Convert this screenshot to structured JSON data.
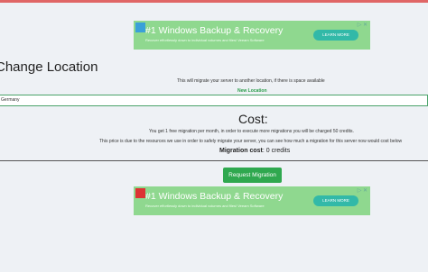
{
  "ads": {
    "top": {
      "title": "#1 Windows Backup & Recovery",
      "subtitle": "Recover effortlessly down to individual volumes and files! Veeam Software",
      "button": "LEARN MORE",
      "info": "▷ ✕",
      "logo": "veeam"
    },
    "bottom": {
      "title": "#1 Windows Backup & Recovery",
      "subtitle": "Recover effortlessly down to individual volumes and files! Veeam Software",
      "button": "LEARN MORE",
      "info": "▷ ✕",
      "logo": "veeam"
    }
  },
  "change_location": {
    "title": "Change Location",
    "description": "This will migrate your server to another location, if there is space available",
    "new_location_label": "New Location",
    "selected_location": "Germany"
  },
  "cost": {
    "title": "Cost:",
    "line1": "You get 1 free migration per month, in order to execute more migrations you will be charged 50 credits.",
    "line2": "This price is due to the resources we use in order to safely migrate your server, you can see how much a migration for this server now would cost below",
    "migration_cost_label": "Migration cost",
    "migration_cost_value": ": 0 credits"
  },
  "actions": {
    "request_migration": "Request Migration"
  },
  "colors": {
    "accent_top": "#e06666",
    "ad_background": "#8fd88f",
    "primary_button": "#2fa84f"
  }
}
